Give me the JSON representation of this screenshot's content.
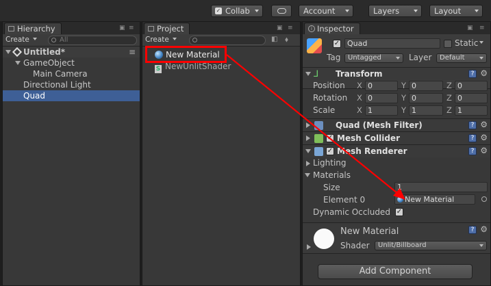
{
  "toolbar": {
    "collab": "Collab",
    "account": "Account",
    "layers": "Layers",
    "layout": "Layout"
  },
  "hierarchy": {
    "tab": "Hierarchy",
    "create": "Create",
    "search_placeholder": "All",
    "scene": "Untitled*",
    "items": [
      "GameObject",
      "Main Camera",
      "Directional Light",
      "Quad"
    ]
  },
  "project": {
    "tab": "Project",
    "create": "Create",
    "items": [
      "New Material",
      "NewUnlitShader"
    ]
  },
  "inspector": {
    "tab": "Inspector",
    "object_name": "Quad",
    "static_label": "Static",
    "tag_label": "Tag",
    "tag_value": "Untagged",
    "layer_label": "Layer",
    "layer_value": "Default",
    "transform": {
      "title": "Transform",
      "rows": [
        {
          "label": "Position",
          "x": "0",
          "y": "0",
          "z": "0"
        },
        {
          "label": "Rotation",
          "x": "0",
          "y": "0",
          "z": "0"
        },
        {
          "label": "Scale",
          "x": "1",
          "y": "1",
          "z": "1"
        }
      ],
      "axis_x": "X",
      "axis_y": "Y",
      "axis_z": "Z"
    },
    "mesh_filter": "Quad (Mesh Filter)",
    "mesh_collider": "Mesh Collider",
    "mesh_renderer": {
      "title": "Mesh Renderer",
      "lighting": "Lighting",
      "materials": "Materials",
      "size_label": "Size",
      "size_value": "1",
      "element_label": "Element 0",
      "element_value": "New Material",
      "dynamic_occluded": "Dynamic Occluded"
    },
    "material": {
      "name": "New Material",
      "shader_label": "Shader",
      "shader_value": "Unlit/Billboard"
    },
    "add_component": "Add Component"
  },
  "colors": {
    "selection": "#3e5f96",
    "highlight": "#ff0000",
    "arrow": "#ff0000"
  }
}
